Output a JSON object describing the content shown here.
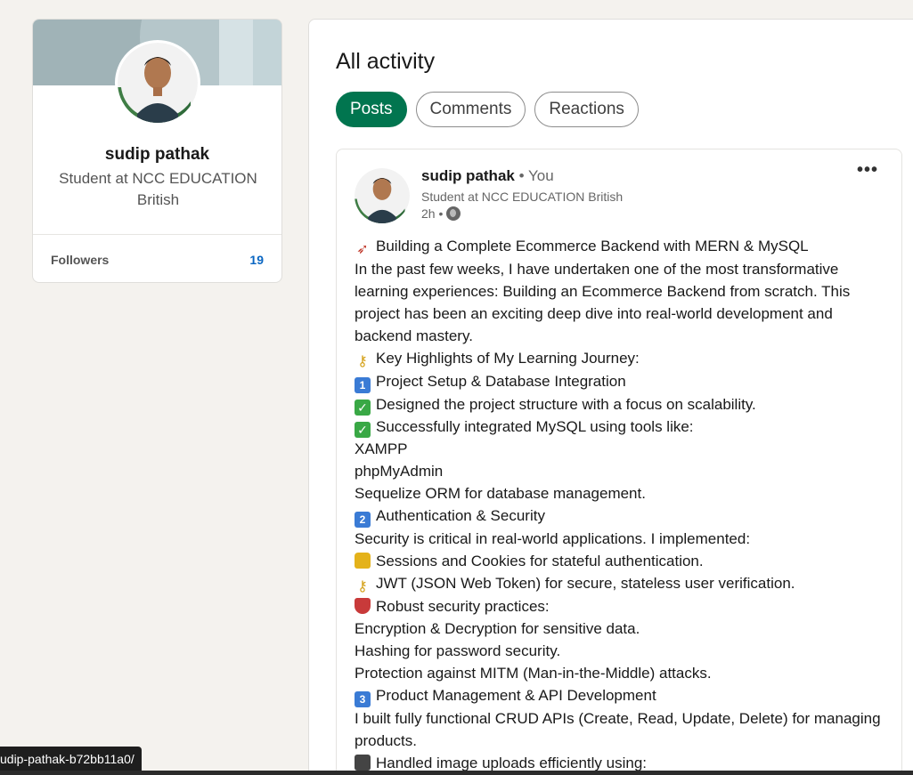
{
  "profile": {
    "name": "sudip pathak",
    "headline": "Student at NCC EDUCATION British",
    "followers_label": "Followers",
    "followers_count": "19",
    "avatar_badge": "#OPENTOWORK"
  },
  "activity": {
    "title": "All activity",
    "tabs": [
      {
        "label": "Posts",
        "active": true
      },
      {
        "label": "Comments",
        "active": false
      },
      {
        "label": "Reactions",
        "active": false
      }
    ]
  },
  "post": {
    "author": "sudip pathak",
    "you_label": "• You",
    "headline": "Student at NCC EDUCATION British",
    "time": "2h •",
    "more_icon": "more-horizontal-icon",
    "lines": [
      "Building a Complete Ecommerce Backend with MERN & MySQL",
      "In the past few weeks, I have undertaken one of the most transformative learning experiences: Building an Ecommerce Backend from scratch. This project has been an exciting deep dive into real-world development and backend mastery.",
      "Key Highlights of My Learning Journey:",
      "Project Setup & Database Integration",
      "Designed the project structure with a focus on scalability.",
      "Successfully integrated MySQL using tools like:",
      "XAMPP",
      "phpMyAdmin",
      "Sequelize ORM for database management.",
      "Authentication & Security",
      "Security is critical in real-world applications. I implemented:",
      "Sessions and Cookies for stateful authentication.",
      "JWT (JSON Web Token) for secure, stateless user verification.",
      "Robust security practices:",
      "Encryption & Decryption for sensitive data.",
      "Hashing for password security.",
      "Protection against MITM (Man-in-the-Middle) attacks.",
      "Product Management & API Development",
      "I built fully functional CRUD APIs (Create, Read, Update, Delete) for managing products.",
      "Handled image uploads efficiently using:"
    ]
  },
  "status_url": "udip-pathak-b72bb11a0/",
  "colors": {
    "accent_green": "#01754f",
    "link_blue": "#0a66c2",
    "background": "#f4f2ee"
  }
}
